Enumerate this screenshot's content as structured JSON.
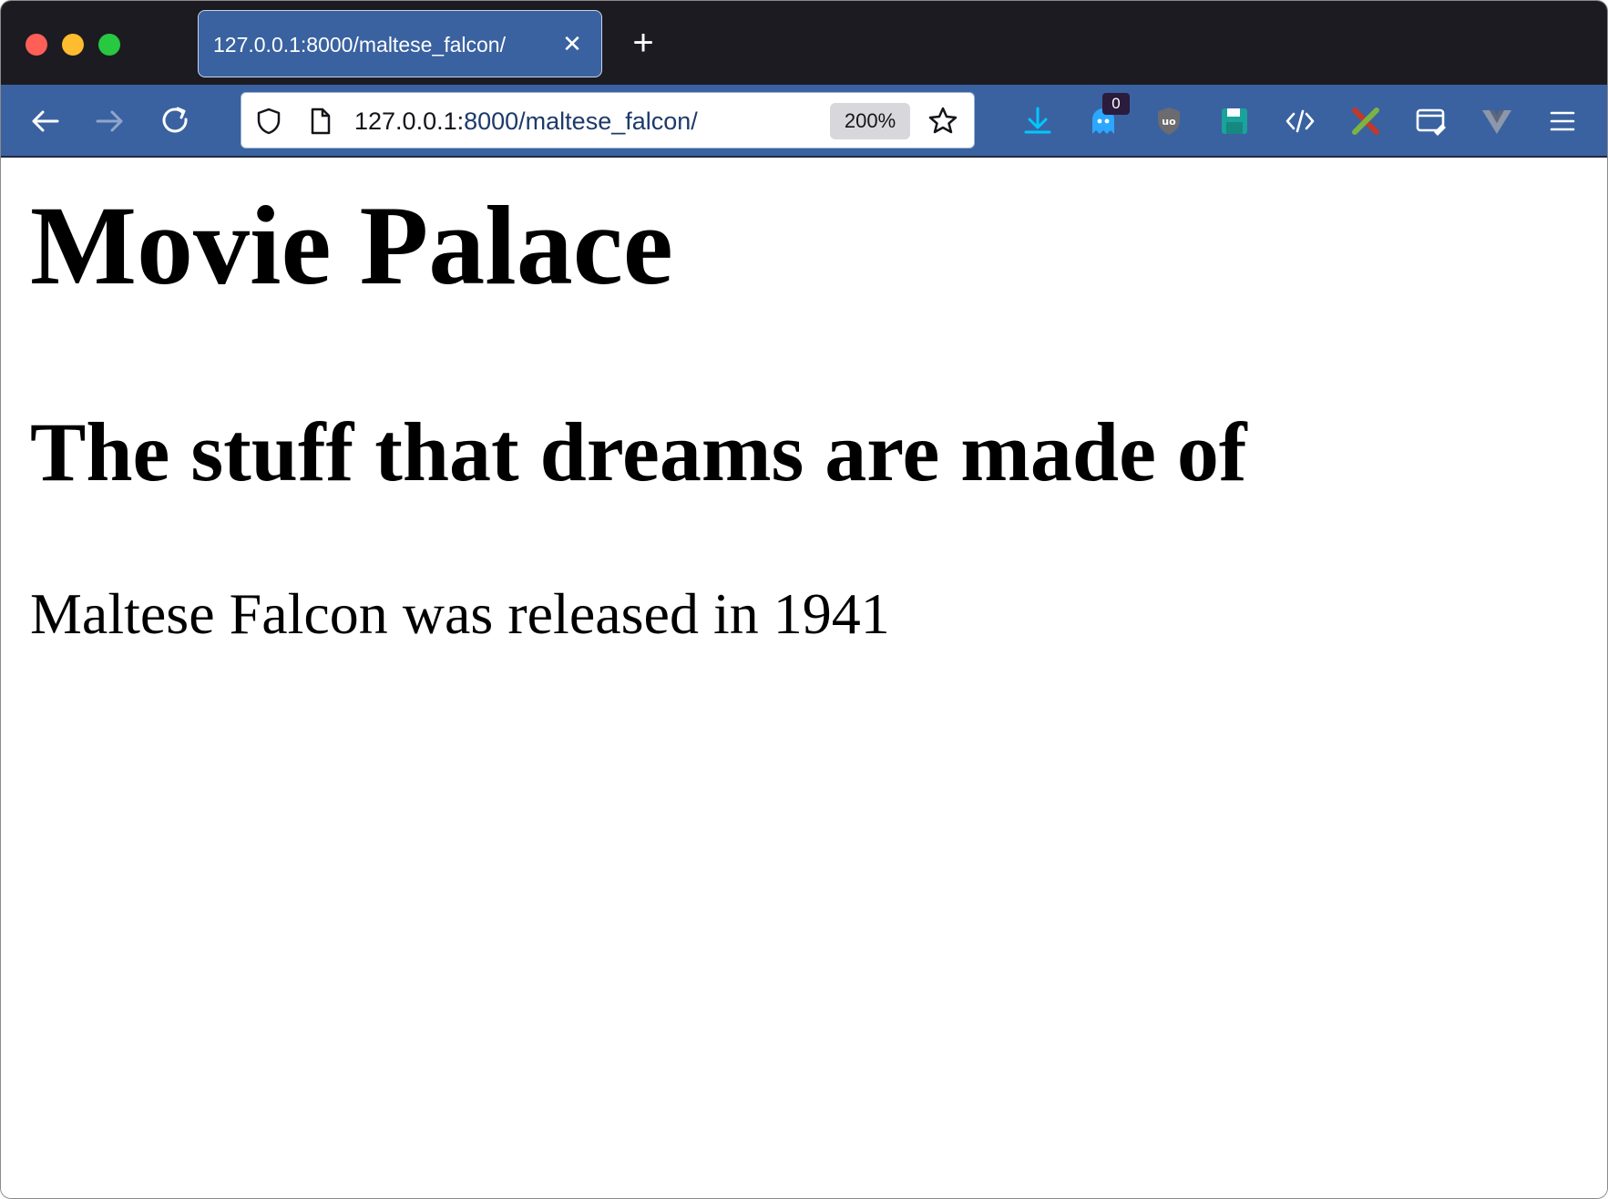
{
  "browser": {
    "tab": {
      "title": "127.0.0.1:8000/maltese_falcon/",
      "close_glyph": "✕"
    },
    "new_tab_glyph": "+",
    "url": {
      "host": "127.0.0.1:",
      "rest": "8000/maltese_falcon/"
    },
    "zoom": "200%",
    "extension_badge": "0",
    "icons": [
      "back-icon",
      "forward-icon",
      "reload-icon",
      "shield-icon",
      "page-icon",
      "star-icon",
      "download-icon",
      "ghost-icon",
      "ublock-icon",
      "save-icon",
      "code-icon",
      "pencil-icon",
      "window-edit-icon",
      "vue-icon",
      "menu-icon"
    ],
    "colors": {
      "toolbar": "#3a62a0",
      "tabstrip": "#1c1b22",
      "download": "#00c8ff",
      "ghost": "#2aa7ff",
      "save": "#1aa39a"
    }
  },
  "page": {
    "h1": "Movie Palace",
    "h2": "The stuff that dreams are made of",
    "paragraph": "Maltese Falcon was released in 1941"
  }
}
